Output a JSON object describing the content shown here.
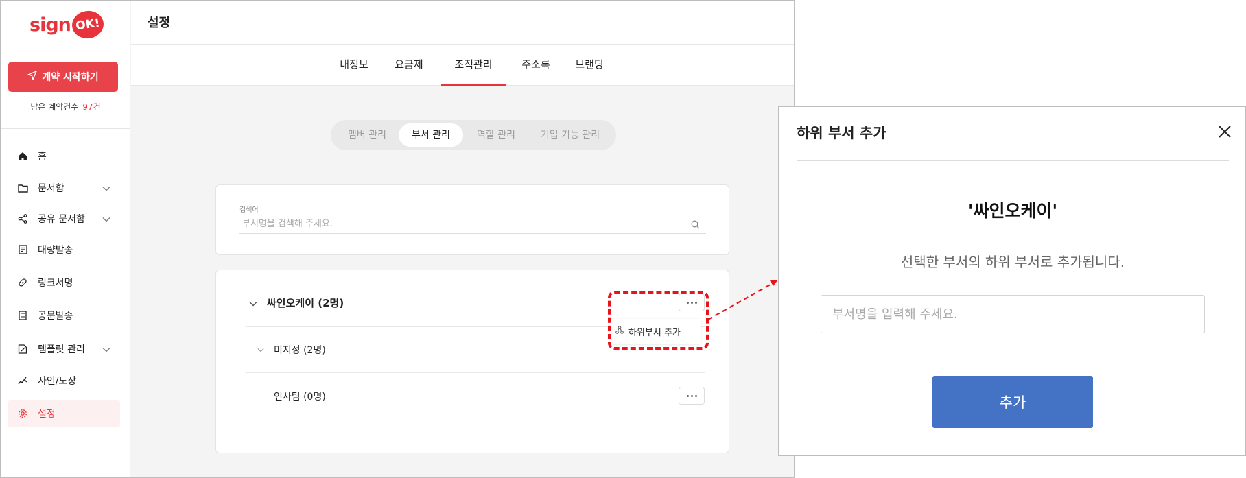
{
  "brand": {
    "logo_sign": "sign",
    "logo_ok": "OK!",
    "accent": "#e8333b",
    "button_blue": "#4472c4"
  },
  "sidebar": {
    "cta_label": "계약 시작하기",
    "remaining_label": "남은 계약건수",
    "remaining_count": "97건",
    "items": [
      {
        "label": "홈",
        "icon": "home-icon",
        "chevron": false,
        "active": false
      },
      {
        "label": "문서함",
        "icon": "folder-icon",
        "chevron": true,
        "active": false
      },
      {
        "label": "공유 문서함",
        "icon": "share-icon",
        "chevron": true,
        "active": false
      },
      {
        "label": "대량발송",
        "icon": "bulk-send-icon",
        "chevron": false,
        "active": false
      },
      {
        "label": "링크서명",
        "icon": "link-icon",
        "chevron": false,
        "active": false
      },
      {
        "label": "공문발송",
        "icon": "document-icon",
        "chevron": false,
        "active": false
      },
      {
        "label": "템플릿 관리",
        "icon": "template-icon",
        "chevron": true,
        "active": false
      },
      {
        "label": "사인/도장",
        "icon": "signature-icon",
        "chevron": false,
        "active": false
      },
      {
        "label": "설정",
        "icon": "gear-icon",
        "chevron": false,
        "active": true
      }
    ]
  },
  "header": {
    "title": "설정"
  },
  "tabs": [
    {
      "label": "내정보",
      "active": false
    },
    {
      "label": "요금제",
      "active": false
    },
    {
      "label": "조직관리",
      "active": true
    },
    {
      "label": "주소록",
      "active": false
    },
    {
      "label": "브랜딩",
      "active": false
    }
  ],
  "segments": [
    {
      "label": "멤버 관리",
      "active": false
    },
    {
      "label": "부서 관리",
      "active": true
    },
    {
      "label": "역할 관리",
      "active": false
    },
    {
      "label": "기업 기능 관리",
      "active": false
    }
  ],
  "search": {
    "label": "검색어",
    "placeholder": "부서명을 검색해 주세요.",
    "value": ""
  },
  "departments": {
    "root": "싸인오케이 (2명)",
    "child1": "미지정 (2명)",
    "child2": "인사팀 (0명)",
    "menu_item": "하위부서 추가"
  },
  "dialog": {
    "title": "하위 부서 추가",
    "dept_name": "'싸인오케이'",
    "description": "선택한 부서의 하위 부서로 추가됩니다.",
    "input_placeholder": "부서명을 입력해 주세요.",
    "input_value": "",
    "submit_label": "추가"
  }
}
